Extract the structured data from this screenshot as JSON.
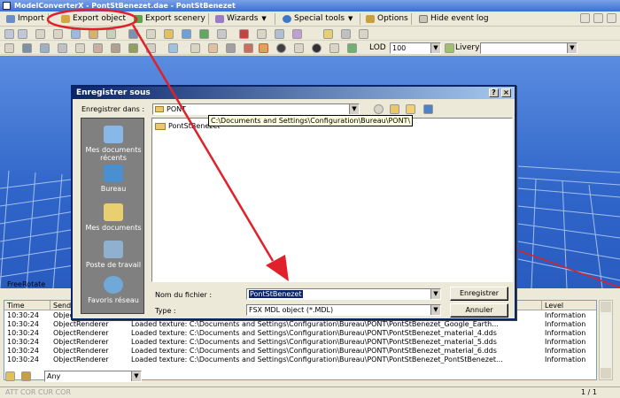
{
  "window": {
    "title": "ModelConverterX - PontStBenezet.dae - PontStBenezet"
  },
  "menubar": {
    "import": "Import",
    "export_object": "Export object",
    "export_scenery": "Export scenery",
    "wizards": "Wizards",
    "special_tools": "Special tools",
    "options": "Options",
    "hide_event_log": "Hide event log"
  },
  "toolbar3": {
    "lod_label": "LOD",
    "lod_value": "100",
    "livery_label": "Livery"
  },
  "viewport": {
    "mode_label": "FreeRotate"
  },
  "dialog": {
    "title": "Enregistrer sous",
    "save_in_label": "Enregistrer dans :",
    "save_in_value": "PONT",
    "path_tooltip": "C:\\Documents and Settings\\Configuration\\Bureau\\PONT\\",
    "files": [
      {
        "name": "PontStBenezet"
      }
    ],
    "places": [
      {
        "label": "Mes documents récents"
      },
      {
        "label": "Bureau"
      },
      {
        "label": "Mes documents"
      },
      {
        "label": "Poste de travail"
      },
      {
        "label": "Favoris réseau"
      }
    ],
    "filename_label": "Nom du fichier :",
    "filename_value": "PontStBenezet",
    "type_label": "Type :",
    "type_value": "FSX MDL object (*.MDL)",
    "save_button": "Enregistrer",
    "cancel_button": "Annuler"
  },
  "event_log": {
    "columns": [
      "Time",
      "Sender",
      "Level"
    ],
    "rows": [
      {
        "time": "10:30:24",
        "sender": "Object",
        "message": "",
        "level": "Information"
      },
      {
        "time": "10:30:24",
        "sender": "ObjectRenderer",
        "message": "Loaded texture: C:\\Documents and Settings\\Configuration\\Bureau\\PONT\\PontStBenezet_Google_Earth...",
        "level": "Information"
      },
      {
        "time": "10:30:24",
        "sender": "ObjectRenderer",
        "message": "Loaded texture: C:\\Documents and Settings\\Configuration\\Bureau\\PONT\\PontStBenezet_material_4.dds",
        "level": "Information"
      },
      {
        "time": "10:30:24",
        "sender": "ObjectRenderer",
        "message": "Loaded texture: C:\\Documents and Settings\\Configuration\\Bureau\\PONT\\PontStBenezet_material_5.dds",
        "level": "Information"
      },
      {
        "time": "10:30:24",
        "sender": "ObjectRenderer",
        "message": "Loaded texture: C:\\Documents and Settings\\Configuration\\Bureau\\PONT\\PontStBenezet_material_6.dds",
        "level": "Information"
      },
      {
        "time": "10:30:24",
        "sender": "ObjectRenderer",
        "message": "Loaded texture: C:\\Documents and Settings\\Configuration\\Bureau\\PONT\\PontStBenezet_PontStBenezet...",
        "level": "Information"
      }
    ],
    "filter_value": "Any",
    "status_left": "ATT COR  CUR COR",
    "page_indicator": "1 / 1"
  },
  "colors": {
    "annotation": "#e0202a",
    "viewport_bg": "#2f64c8",
    "dialog_title": "#0a246a"
  }
}
